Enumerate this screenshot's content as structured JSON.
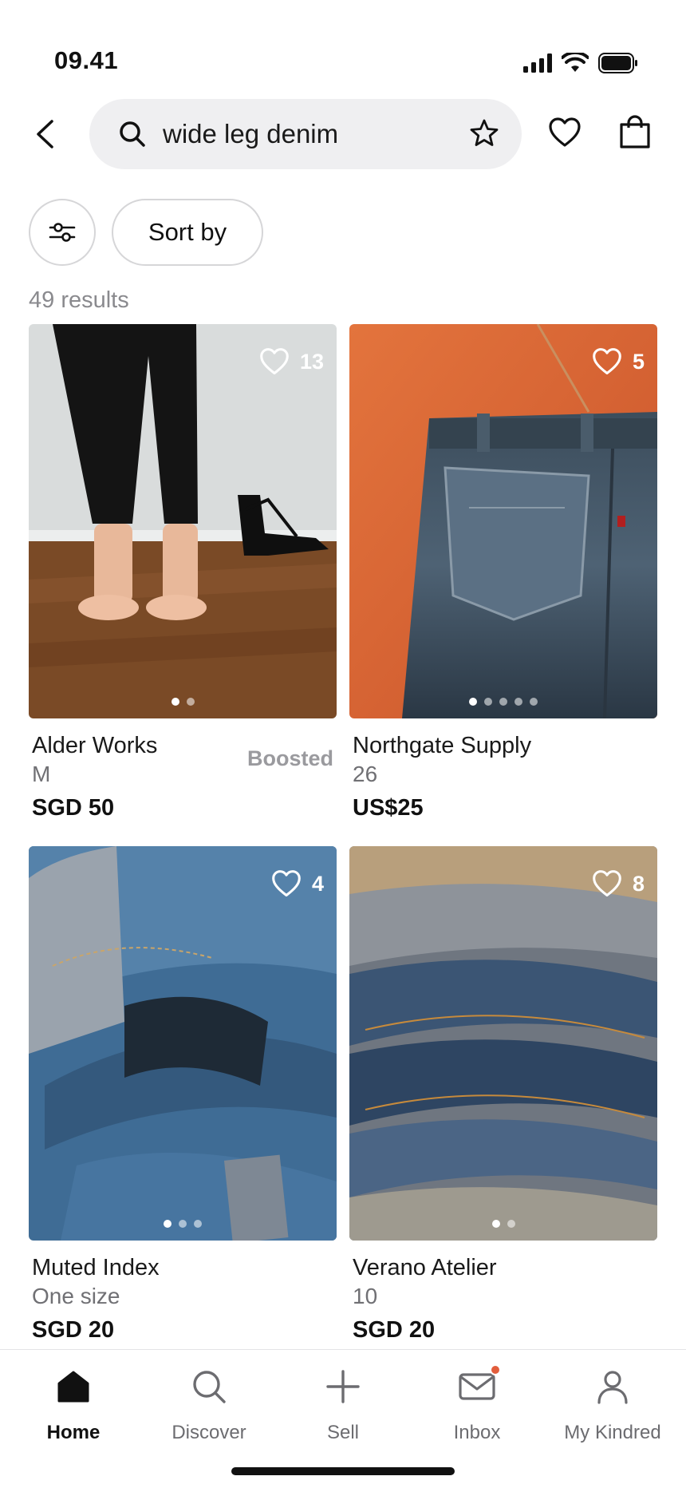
{
  "status_bar": {
    "time": "09.41"
  },
  "header": {
    "search_value": "wide leg denim"
  },
  "filters": {
    "sort_label": "Sort by"
  },
  "results_count": "49 results",
  "products": [
    {
      "brand": "Alder Works",
      "tag": "Boosted",
      "size": "M",
      "price": "SGD 50",
      "likes": "13",
      "image_dots": 2,
      "active_dot": 0
    },
    {
      "brand": "Northgate Supply",
      "tag": "",
      "size": "26",
      "price": "US$25",
      "likes": "5",
      "image_dots": 5,
      "active_dot": 0
    },
    {
      "brand": "Muted Index",
      "tag": "",
      "size": "One size",
      "price": "SGD 20",
      "likes": "4",
      "image_dots": 3,
      "active_dot": 0
    },
    {
      "brand": "Verano Atelier",
      "tag": "",
      "size": "10",
      "price": "SGD 20",
      "likes": "8",
      "image_dots": 2,
      "active_dot": 0
    }
  ],
  "bottom_nav": {
    "items": [
      {
        "label": "Home",
        "icon": "home-icon",
        "active": true
      },
      {
        "label": "Discover",
        "icon": "search-icon",
        "active": false
      },
      {
        "label": "Sell",
        "icon": "plus-icon",
        "active": false
      },
      {
        "label": "Inbox",
        "icon": "mail-icon",
        "active": false,
        "notification": true
      },
      {
        "label": "My Kindred",
        "icon": "profile-icon",
        "active": false
      }
    ]
  },
  "colors": {
    "accent_notification": "#e25d3c",
    "muted_text": "#8a8a8e",
    "search_bg": "#efeff1"
  }
}
